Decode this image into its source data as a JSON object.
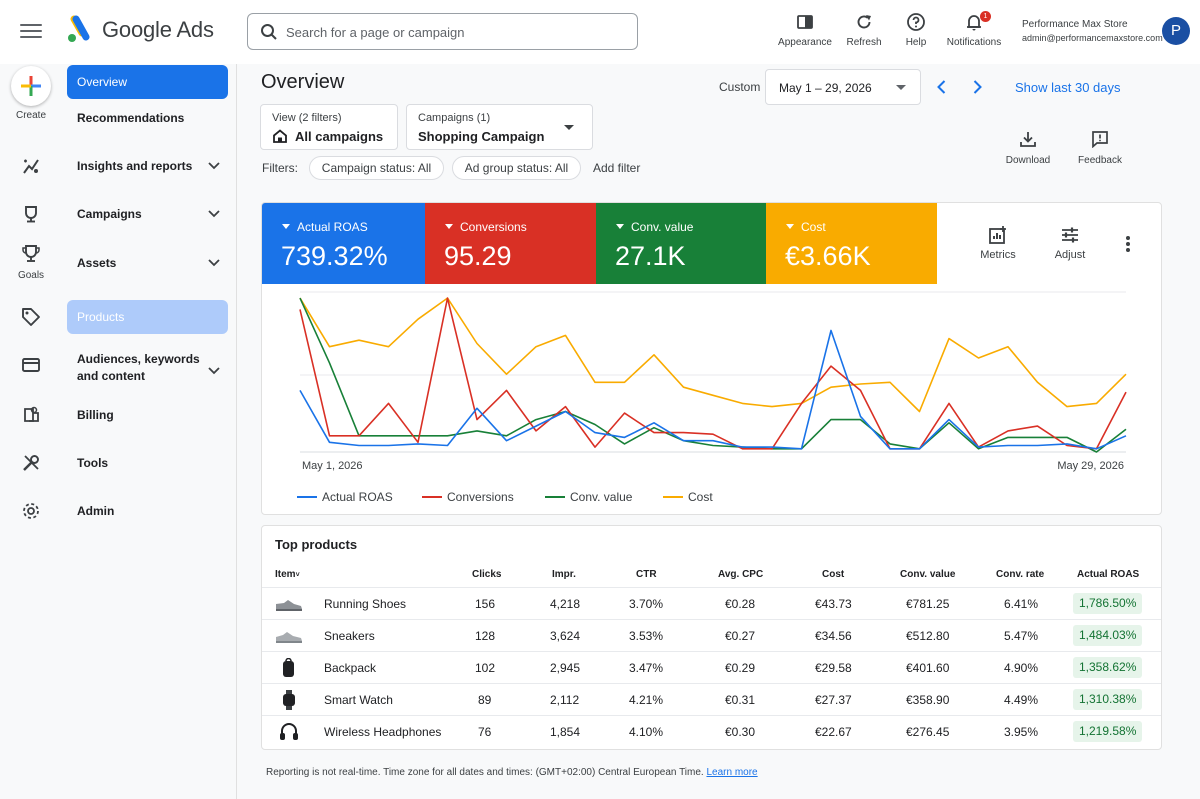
{
  "app": {
    "brand": "Google Ads"
  },
  "search": {
    "placeholder": "Search for a page or campaign"
  },
  "toolbar": {
    "appearance": "Appearance",
    "refresh": "Refresh",
    "help": "Help",
    "notifications": "Notifications",
    "notification_count": "1"
  },
  "account": {
    "name": "Performance Max Store",
    "email": "admin@performancemaxstore.com",
    "avatar_letter": "P"
  },
  "rail": {
    "create": "Create",
    "goals": "Goals"
  },
  "sidenav": {
    "items": [
      {
        "label": "Overview",
        "icon": "home-icon"
      },
      {
        "label": "Recommendations",
        "icon": "lightbulb-icon"
      },
      {
        "label": "Insights and reports",
        "icon": "insights-icon"
      },
      {
        "label": "Campaigns",
        "icon": "campaigns-icon"
      },
      {
        "label": "Assets",
        "icon": "trophy-icon"
      },
      {
        "label": "Products",
        "icon": "tag-icon"
      },
      {
        "label": "Audiences, keywords and content",
        "icon": "card-icon"
      },
      {
        "label": "Billing",
        "icon": "billing-icon"
      },
      {
        "label": "Tools",
        "icon": "tools-icon"
      },
      {
        "label": "Admin",
        "icon": "gear-icon"
      }
    ]
  },
  "header": {
    "title": "Overview",
    "custom_label": "Custom",
    "date_range": "May 1 – 29, 2026",
    "show_last": "Show last 30 days"
  },
  "view_filter": {
    "subtitle": "View (2 filters)",
    "value": "All campaigns"
  },
  "campaign_filter": {
    "subtitle": "Campaigns (1)",
    "value": "Shopping Campaign"
  },
  "filters": {
    "label": "Filters:",
    "campaign_status": "Campaign status: All",
    "ad_group_status": "Ad group status: All",
    "add_filter": "Add filter"
  },
  "actions": {
    "download": "Download",
    "feedback": "Feedback"
  },
  "scorecards": [
    {
      "label": "Actual ROAS",
      "value": "739.32%",
      "color": "#1a73e8"
    },
    {
      "label": "Conversions",
      "value": "95.29",
      "color": "#d93025"
    },
    {
      "label": "Conv. value",
      "value": "27.1K",
      "color": "#188038"
    },
    {
      "label": "Cost",
      "value": "€3.66K",
      "color": "#f9ab00"
    }
  ],
  "card_actions": {
    "metrics": "Metrics",
    "adjust": "Adjust"
  },
  "chart_data": {
    "type": "line",
    "x_start_label": "May 1, 2026",
    "x_end_label": "May 29, 2026",
    "x": [
      1,
      2,
      3,
      4,
      5,
      6,
      7,
      8,
      9,
      10,
      11,
      12,
      13,
      14,
      15,
      16,
      17,
      18,
      19,
      20,
      21,
      22,
      23,
      24,
      25,
      26,
      27,
      28,
      29
    ],
    "grid": true,
    "series": [
      {
        "name": "Actual ROAS",
        "color": "#1a73e8",
        "values": [
          38,
          6,
          4,
          4,
          5,
          4,
          27,
          7,
          16,
          25,
          12,
          9,
          18,
          7,
          7,
          3,
          3,
          2,
          75,
          22,
          2,
          2,
          20,
          3,
          4,
          4,
          5,
          2,
          10
        ]
      },
      {
        "name": "Conversions",
        "color": "#d93025",
        "values": [
          88,
          10,
          10,
          30,
          6,
          95,
          20,
          38,
          13,
          28,
          3,
          24,
          12,
          12,
          11,
          2,
          2,
          30,
          53,
          38,
          2,
          2,
          30,
          3,
          13,
          16,
          4,
          2,
          37
        ]
      },
      {
        "name": "Conv. value",
        "color": "#188038",
        "values": [
          95,
          55,
          10,
          10,
          10,
          10,
          13,
          10,
          20,
          25,
          17,
          5,
          15,
          7,
          4,
          3,
          2,
          2,
          20,
          20,
          5,
          2,
          18,
          2,
          9,
          9,
          9,
          0,
          14
        ]
      },
      {
        "name": "Cost",
        "color": "#f9ab00",
        "values": [
          95,
          65,
          69,
          65,
          82,
          95,
          67,
          48,
          65,
          72,
          43,
          43,
          60,
          40,
          35,
          30,
          28,
          30,
          40,
          42,
          43,
          25,
          70,
          58,
          65,
          43,
          28,
          30,
          48
        ]
      }
    ]
  },
  "table": {
    "title": "Top products",
    "headers": [
      "Item",
      "Clicks",
      "Impr.",
      "CTR",
      "Avg. CPC",
      "Cost",
      "Conv. value",
      "Conv. rate",
      "Actual ROAS"
    ],
    "rows": [
      {
        "item": "Running Shoes",
        "icon": "shoe-icon",
        "clicks": "156",
        "impr": "4,218",
        "ctr": "3.70%",
        "cpc": "€0.28",
        "cost": "€43.73",
        "conv_value": "€781.25",
        "conv_rate": "6.41%",
        "roas": "1,786.50%"
      },
      {
        "item": "Sneakers",
        "icon": "sneaker-icon",
        "clicks": "128",
        "impr": "3,624",
        "ctr": "3.53%",
        "cpc": "€0.27",
        "cost": "€34.56",
        "conv_value": "€512.80",
        "conv_rate": "5.47%",
        "roas": "1,484.03%"
      },
      {
        "item": "Backpack",
        "icon": "backpack-icon",
        "clicks": "102",
        "impr": "2,945",
        "ctr": "3.47%",
        "cpc": "€0.29",
        "cost": "€29.58",
        "conv_value": "€401.60",
        "conv_rate": "4.90%",
        "roas": "1,358.62%"
      },
      {
        "item": "Smart Watch",
        "icon": "watch-icon",
        "clicks": "89",
        "impr": "2,112",
        "ctr": "4.21%",
        "cpc": "€0.31",
        "cost": "€27.37",
        "conv_value": "€358.90",
        "conv_rate": "4.49%",
        "roas": "1,310.38%"
      },
      {
        "item": "Wireless Headphones",
        "icon": "headphones-icon",
        "clicks": "76",
        "impr": "1,854",
        "ctr": "4.10%",
        "cpc": "€0.30",
        "cost": "€22.67",
        "conv_value": "€276.45",
        "conv_rate": "3.95%",
        "roas": "1,219.58%"
      }
    ]
  },
  "footer": {
    "text": "Reporting is not real-time. Time zone for all dates and times: (GMT+02:00) Central European Time.",
    "link": "Learn more"
  }
}
